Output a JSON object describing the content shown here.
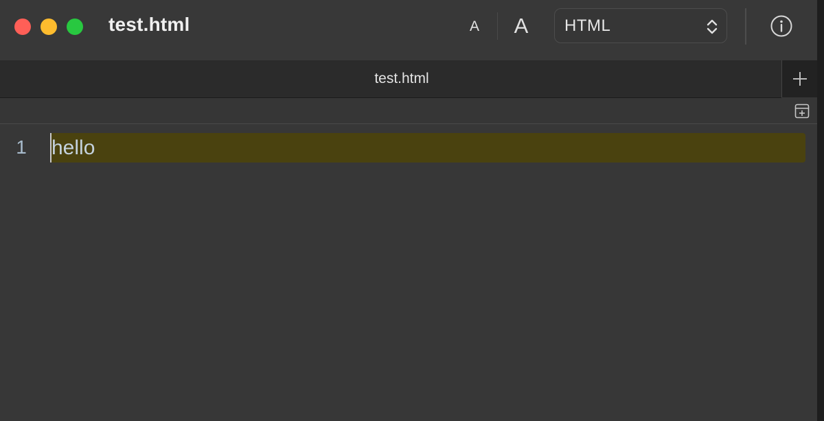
{
  "window": {
    "title": "test.html",
    "traffic_lights": {
      "close_color": "#ff5f57",
      "minimize_color": "#febc2e",
      "maximize_color": "#28c840"
    }
  },
  "toolbar": {
    "font_smaller_label": "A",
    "font_larger_label": "A",
    "syntax_select": {
      "value": "HTML",
      "icon": "chevron-up-down-icon"
    },
    "info_icon": "info-circle-icon"
  },
  "tabs": [
    {
      "label": "test.html",
      "active": true
    }
  ],
  "new_tab_icon": "plus-icon",
  "split_editor_icon": "split-editor-icon",
  "editor": {
    "lines": [
      {
        "number": "1",
        "text": "hello",
        "highlighted": true
      }
    ],
    "highlight_color": "#4a420f"
  }
}
